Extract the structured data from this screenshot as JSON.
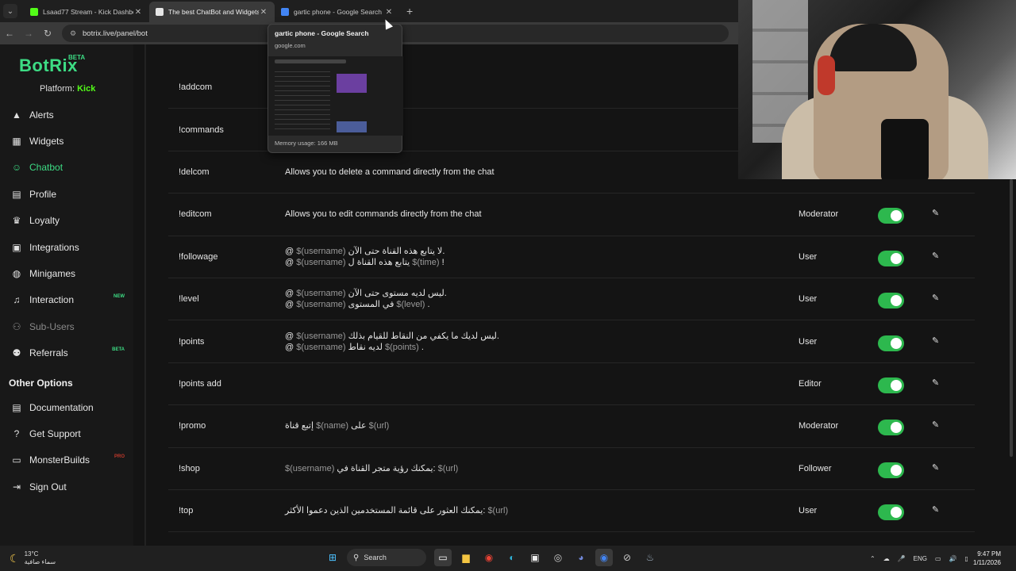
{
  "browser": {
    "tabs": [
      {
        "title": "Lsaad77 Stream - Kick Dashboard",
        "favicon_color": "#53fc18",
        "active": false
      },
      {
        "title": "The best ChatBot and Widgets",
        "favicon_color": "#e6e6e6",
        "active": true
      },
      {
        "title": "gartic phone - Google Search",
        "favicon_color": "#4285f4",
        "active": false
      }
    ],
    "url": "botrix.live/panel/bot",
    "tab_preview": {
      "title": "gartic phone - Google Search",
      "domain": "google.com",
      "memory": "Memory usage: 166 MB"
    }
  },
  "sidebar": {
    "logo": "BotRix",
    "logo_badge": "BETA",
    "platform_label": "Platform:",
    "platform_value": "Kick",
    "items": [
      {
        "label": "Alerts",
        "icon": "warning-icon"
      },
      {
        "label": "Widgets",
        "icon": "grid-icon"
      },
      {
        "label": "Chatbot",
        "icon": "robot-icon",
        "active": true
      },
      {
        "label": "Profile",
        "icon": "id-card-icon"
      },
      {
        "label": "Loyalty",
        "icon": "trophy-icon"
      },
      {
        "label": "Integrations",
        "icon": "plug-icon"
      },
      {
        "label": "Minigames",
        "icon": "gamepad-icon"
      },
      {
        "label": "Interaction",
        "icon": "music-icon",
        "tag": "NEW"
      },
      {
        "label": "Sub-Users",
        "icon": "users-icon",
        "muted": true
      },
      {
        "label": "Referrals",
        "icon": "referral-icon",
        "tag": "BETA"
      }
    ],
    "other_heading": "Other Options",
    "other_items": [
      {
        "label": "Documentation",
        "icon": "book-icon"
      },
      {
        "label": "Get Support",
        "icon": "question-icon"
      },
      {
        "label": "MonsterBuilds",
        "icon": "monitor-icon",
        "tag": "PRO"
      },
      {
        "label": "Sign Out",
        "icon": "signout-icon"
      }
    ]
  },
  "commands": [
    {
      "name": "!addcom",
      "response_plain": "d directly from the chat",
      "permission": "",
      "toggle": false
    },
    {
      "name": "!commands",
      "response": [
        [
          "يمكنك ",
          "$(url)"
        ]
      ],
      "permission": "",
      "toggle": false
    },
    {
      "name": "!delcom",
      "response_plain": "Allows you to delete a command directly from the chat",
      "permission": "",
      "toggle": false
    },
    {
      "name": "!editcom",
      "response_plain": "Allows you to edit commands directly from the chat",
      "permission": "Moderator",
      "toggle": true
    },
    {
      "name": "!followage",
      "response": [
        [
          "@ ",
          "$(username)",
          " لا يتابع هذه القناة حتى الآن."
        ],
        [
          "@ ",
          "$(username)",
          " يتابع هذه القناة ل ",
          "$(time)",
          " !"
        ]
      ],
      "permission": "User",
      "toggle": true
    },
    {
      "name": "!level",
      "response": [
        [
          "@ ",
          "$(username)",
          " ليس لديه مستوى حتى الآن."
        ],
        [
          "@ ",
          "$(username)",
          " في المستوى ",
          "$(level)",
          " ."
        ]
      ],
      "permission": "User",
      "toggle": true
    },
    {
      "name": "!points",
      "response": [
        [
          "@ ",
          "$(username)",
          " ليس لديك ما يكفي من النقاط للقيام بذلك."
        ],
        [
          "@ ",
          "$(username)",
          " لديه نقاط ",
          "$(points)",
          " ."
        ]
      ],
      "permission": "User",
      "toggle": true
    },
    {
      "name": "!points add",
      "response_plain": "",
      "permission": "Editor",
      "toggle": true
    },
    {
      "name": "!promo",
      "response": [
        [
          "إتبع قناة ",
          "$(name)",
          " على ",
          "$(url)"
        ]
      ],
      "permission": "Moderator",
      "toggle": true
    },
    {
      "name": "!shop",
      "response": [
        [
          "$(username)",
          " يمكنك رؤية متجر القناة في: ",
          "$(url)"
        ]
      ],
      "permission": "Follower",
      "toggle": true
    },
    {
      "name": "!top",
      "response": [
        [
          "يمكنك العثور على قائمة المستخدمين الذين دعموا الأكثر: ",
          "$(url)"
        ]
      ],
      "permission": "User",
      "toggle": true
    }
  ],
  "taskbar": {
    "temperature": "13°C",
    "weather_text": "سماء صافية",
    "search_label": "Search",
    "lang": "ENG",
    "time": "9:47 PM",
    "date": "1/11/2026"
  }
}
